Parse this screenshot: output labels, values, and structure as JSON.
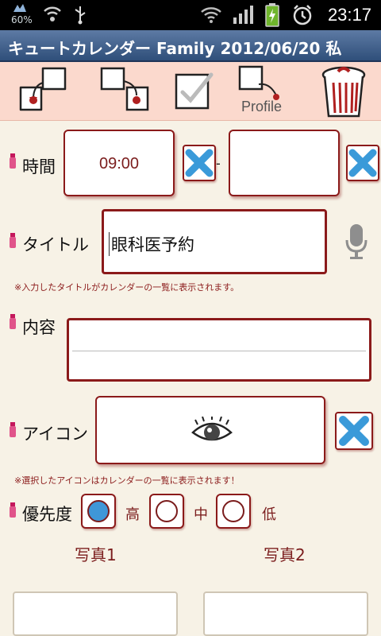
{
  "status": {
    "battery_pct": "60%",
    "time": "23:17"
  },
  "app": {
    "title": "キュートカレンダー Family 2012/06/20 私"
  },
  "toolbar": {
    "profile_label": "Profile"
  },
  "form": {
    "time_label": "時間",
    "start_time": "09:00",
    "end_time": "",
    "time_separator": "-",
    "title_label": "タイトル",
    "title_value": "眼科医予約",
    "title_note": "※入力したタイトルがカレンダーの一覧に表示されます。",
    "content_label": "内容",
    "content_value": "",
    "icon_label": "アイコン",
    "icon_note": "※選択したアイコンはカレンダーの一覧に表示されます！",
    "priority_label": "優先度",
    "priority_options": [
      "高",
      "中",
      "低"
    ],
    "priority_selected": "高",
    "photo1_label": "写真1",
    "photo2_label": "写真2"
  },
  "colors": {
    "accent": "#8b1a1a",
    "toolbar_bg": "#fbd9cd",
    "page_bg": "#f7f2e6",
    "radio_fill": "#3f97d8",
    "delete_x": "#3a9ad9"
  },
  "icons": [
    "battery-icon",
    "wifi-icon",
    "usb-icon",
    "signal-icon",
    "charging-battery-icon",
    "alarm-icon",
    "copy-to-icon",
    "copy-from-icon",
    "check-icon",
    "profile-icon",
    "trash-icon",
    "microphone-icon",
    "eye-icon",
    "delete-x-icon",
    "pin-icon"
  ]
}
